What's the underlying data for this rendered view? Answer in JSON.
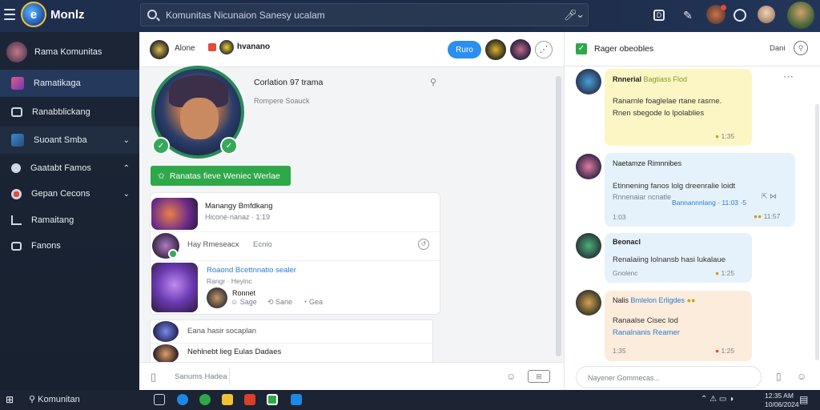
{
  "topbar": {
    "brand": "Monlz",
    "logo_letter": "e",
    "search_text": "Komunitas Nicunaion Sanesy ucalam"
  },
  "sidebar": {
    "items": [
      {
        "label": "Rama Komunitas",
        "caret": ""
      },
      {
        "label": "Ramatikaga",
        "caret": ""
      },
      {
        "label": "Ranabblickang",
        "caret": ""
      },
      {
        "label": "Suoant Smba",
        "caret": "⌄"
      },
      {
        "label": "Gaatabt Famos",
        "caret": "⌃"
      },
      {
        "label": "Gepan Cecons",
        "caret": "⌄"
      },
      {
        "label": "Ramaitang",
        "caret": ""
      },
      {
        "label": "Fanons",
        "caret": ""
      }
    ]
  },
  "main": {
    "header": {
      "tab1": "Alone",
      "tab2_line1": "hvanano",
      "tab2_line2": "",
      "blue_button": "Ruro"
    },
    "profile": {
      "name": "Corlation 97 trama",
      "subtitle": "Rompere Soauck",
      "green_button": "Ranatas fieve Weniec Werlae"
    },
    "feed": [
      {
        "title": "Manangy Bmfdkang",
        "meta": "Hicone·nanaz · 1:19"
      },
      {
        "title": "Hay Rmeseacx",
        "meta": "Ecnio"
      },
      {
        "title": "Roaond Bcettnnatio sealer",
        "meta": "Rangr · Heyinc",
        "sub": "Ronnet",
        "actions": [
          "Sage",
          "Sane",
          "Gea"
        ]
      },
      {
        "title": "Eana hasir socaplan"
      },
      {
        "title": "Nehlnebt lieg Eulas Dadaes"
      }
    ],
    "composer_placeholder": "Sanums Hadea"
  },
  "right": {
    "title": "Rager obeobles",
    "link": "Dani",
    "messages": [
      {
        "name": "Rnnerial",
        "name2": "Bagtiass Flod",
        "body1": "Ranarnle foaglelae rtane rasrne.",
        "body2": "Rnen sbegode lo lpolablies",
        "time": "1:35"
      },
      {
        "name": "Naetamze",
        "name2": "Rimnnibes",
        "body1": "Etinnening fanos lolg dreenralie loidt",
        "body2": "Rnnenaiar ncnatle",
        "footer": "Bannannnlang · 11:03 ·5",
        "time": "11:57"
      },
      {
        "name": "Beonacl",
        "name2": "",
        "body1": "Renalaiing lolnansb hasi lukalaue",
        "body2": "Gnolenc",
        "time": "1:25"
      },
      {
        "name": "Nalis",
        "name2": "Bmlelon Erligdes",
        "body1": "Ranaalse Cisec lod",
        "body2": "Ranalnanis Reamer",
        "time": "1:25"
      }
    ],
    "composer_placeholder": "Nayener Gommecas..."
  },
  "taskbar": {
    "search": "Komunitan",
    "time": "12:35 AM",
    "date": "10/06/2024"
  },
  "colors": {
    "accent": "#2a8ff0",
    "green": "#2fa84a",
    "sidebar": "#1b2536"
  }
}
